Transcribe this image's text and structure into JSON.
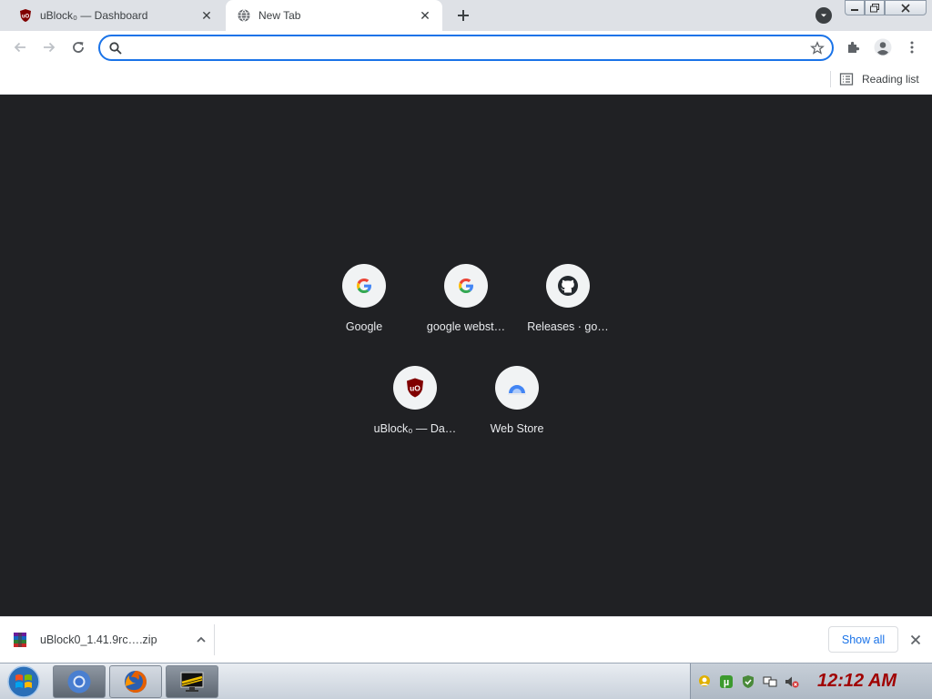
{
  "tabs": [
    {
      "title": "uBlock₀ — Dashboard",
      "active": false
    },
    {
      "title": "New Tab",
      "active": true
    }
  ],
  "omnibox": {
    "value": "",
    "placeholder": ""
  },
  "bookmarks_bar": {
    "reading_list_label": "Reading list"
  },
  "shortcuts": [
    {
      "title": "Google",
      "icon": "google-icon"
    },
    {
      "title": "google webst…",
      "icon": "google-icon"
    },
    {
      "title": "Releases · go…",
      "icon": "github-icon"
    },
    {
      "title": "uBlock₀ — Da…",
      "icon": "ublock-icon"
    },
    {
      "title": "Web Store",
      "icon": "webstore-icon"
    }
  ],
  "download_shelf": {
    "item_name": "uBlock0_1.41.9rc….zip",
    "show_all_label": "Show all"
  },
  "taskbar": {
    "clock": "12:12 AM",
    "pinned": [
      "chrome",
      "firefox",
      "cmd-tool"
    ]
  },
  "colors": {
    "accent": "#1a73e8",
    "ntp_background": "#202124",
    "ublock_red": "#800000",
    "clock": "#a00000"
  }
}
